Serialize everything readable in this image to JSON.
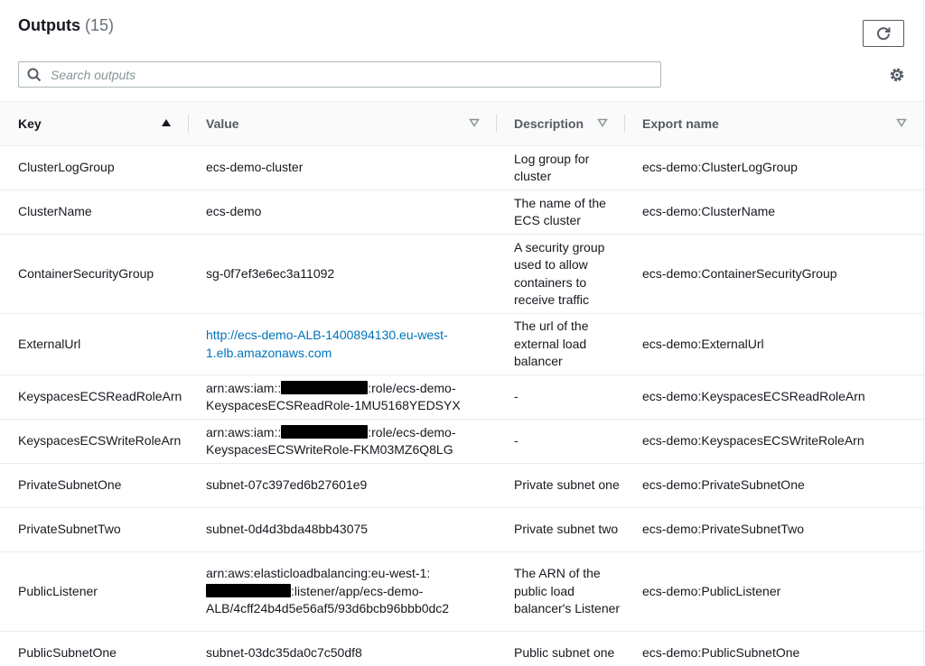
{
  "header": {
    "title": "Outputs",
    "count": "(15)"
  },
  "search": {
    "placeholder": "Search outputs"
  },
  "columns": {
    "key": "Key",
    "value": "Value",
    "description": "Description",
    "export": "Export name"
  },
  "rows": [
    {
      "key": "ClusterLogGroup",
      "value": "ecs-demo-cluster",
      "description": "Log group for cluster",
      "export": "ecs-demo:ClusterLogGroup"
    },
    {
      "key": "ClusterName",
      "value": "ecs-demo",
      "description": "The name of the ECS cluster",
      "export": "ecs-demo:ClusterName"
    },
    {
      "key": "ContainerSecurityGroup",
      "value": "sg-0f7ef3e6ec3a11092",
      "description": "A security group used to allow containers to receive traffic",
      "export": "ecs-demo:ContainerSecurityGroup"
    },
    {
      "key": "ExternalUrl",
      "value": "http://ecs-demo-ALB-1400894130.eu-west-1.elb.amazonaws.com",
      "description": "The url of the external load balancer",
      "export": "ecs-demo:ExternalUrl"
    },
    {
      "key": "KeyspacesECSReadRoleArn",
      "value_prefix": "arn:aws:iam::",
      "value_suffix": ":role/ecs-demo-KeyspacesECSReadRole-1MU5168YEDSYX",
      "description": "-",
      "export": "ecs-demo:KeyspacesECSReadRoleArn"
    },
    {
      "key": "KeyspacesECSWriteRoleArn",
      "value_prefix": "arn:aws:iam::",
      "value_suffix": ":role/ecs-demo-KeyspacesECSWriteRole-FKM03MZ6Q8LG",
      "description": "-",
      "export": "ecs-demo:KeyspacesECSWriteRoleArn"
    },
    {
      "key": "PrivateSubnetOne",
      "value": "subnet-07c397ed6b27601e9",
      "description": "Private subnet one",
      "export": "ecs-demo:PrivateSubnetOne"
    },
    {
      "key": "PrivateSubnetTwo",
      "value": "subnet-0d4d3bda48bb43075",
      "description": "Private subnet two",
      "export": "ecs-demo:PrivateSubnetTwo"
    },
    {
      "key": "PublicListener",
      "value_prefix": "arn:aws:elasticloadbalancing:eu-west-1:",
      "value_suffix": ":listener/app/ecs-demo-ALB/4cff24b4d5e56af5/93d6bcb96bbb0dc2",
      "description": "The ARN of the public load balancer's Listener",
      "export": "ecs-demo:PublicListener"
    },
    {
      "key": "PublicSubnetOne",
      "value": "subnet-03dc35da0c7c50df8",
      "description": "Public subnet one",
      "export": "ecs-demo:PublicSubnetOne"
    }
  ],
  "colors": {
    "link": "#0073bb",
    "header_bg": "#fafafa",
    "border": "#eaeded"
  },
  "icons": {
    "refresh": "refresh-icon",
    "search": "search-icon",
    "settings": "gear-icon",
    "sort_asc": "caret-up-icon",
    "sort_none": "caret-down-icon"
  }
}
